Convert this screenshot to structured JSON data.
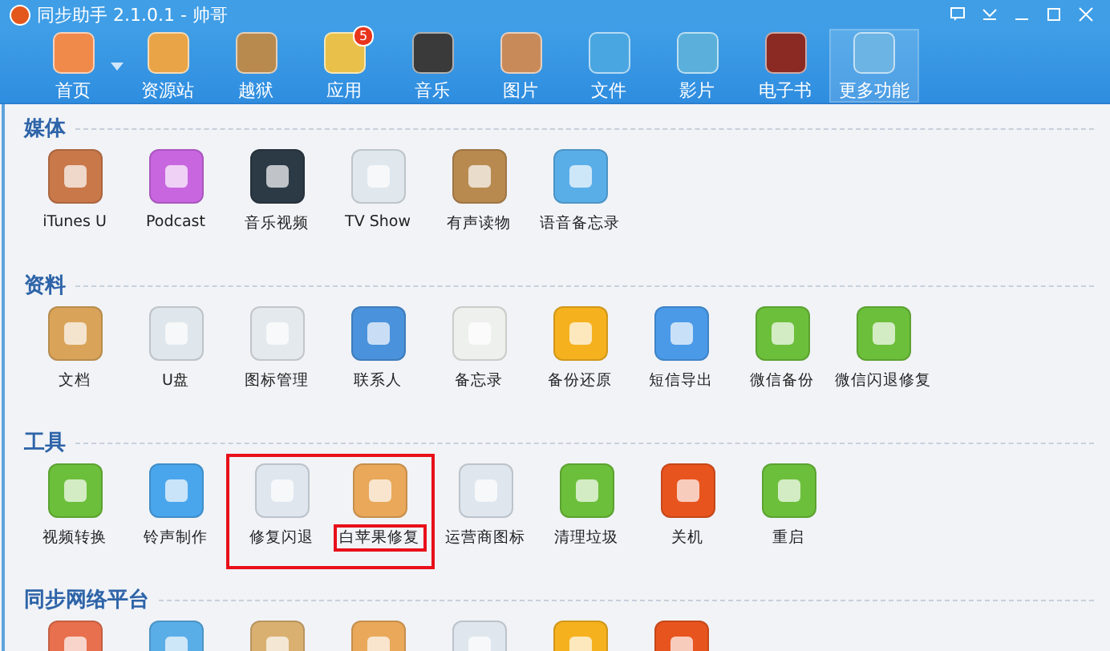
{
  "window": {
    "title": "同步助手 2.1.0.1 - 帅哥"
  },
  "toolbar": [
    {
      "label": "首页",
      "selected": false,
      "color": "#f08a4b",
      "dropdown": true
    },
    {
      "label": "资源站",
      "selected": false,
      "color": "#e9a447"
    },
    {
      "label": "越狱",
      "selected": false,
      "color": "#b98a4e"
    },
    {
      "label": "应用",
      "selected": false,
      "color": "#e9c04a",
      "badge": "5"
    },
    {
      "label": "音乐",
      "selected": false,
      "color": "#3a3a3a"
    },
    {
      "label": "图片",
      "selected": false,
      "color": "#c98a5a"
    },
    {
      "label": "文件",
      "selected": false,
      "color": "#4aa6e0"
    },
    {
      "label": "影片",
      "selected": false,
      "color": "#5ab0da"
    },
    {
      "label": "电子书",
      "selected": false,
      "color": "#8a2a22"
    },
    {
      "label": "更多功能",
      "selected": true,
      "color": "#6cb4e4"
    }
  ],
  "sections": [
    {
      "title": "媒体",
      "items": [
        {
          "label": "iTunes U",
          "color": "#c9784a"
        },
        {
          "label": "Podcast",
          "color": "#c866e0"
        },
        {
          "label": "音乐视频",
          "color": "#2c3a46"
        },
        {
          "label": "TV Show",
          "color": "#e0e8ee"
        },
        {
          "label": "有声读物",
          "color": "#b98a50"
        },
        {
          "label": "语音备忘录",
          "color": "#5aaee8"
        }
      ]
    },
    {
      "title": "资料",
      "items": [
        {
          "label": "文档",
          "color": "#d9a45a"
        },
        {
          "label": "U盘",
          "color": "#dfe6ec"
        },
        {
          "label": "图标管理",
          "color": "#e4e9ee"
        },
        {
          "label": "联系人",
          "color": "#4a92dc"
        },
        {
          "label": "备忘录",
          "color": "#eef0ee"
        },
        {
          "label": "备份还原",
          "color": "#f5b21e"
        },
        {
          "label": "短信导出",
          "color": "#4a9ae8"
        },
        {
          "label": "微信备份",
          "color": "#6cbf3a"
        },
        {
          "label": "微信闪退修复",
          "color": "#6cbf3a"
        }
      ]
    },
    {
      "title": "工具",
      "items": [
        {
          "label": "视频转换",
          "color": "#6cbf3a",
          "boxed": false,
          "label_boxed": false
        },
        {
          "label": "铃声制作",
          "color": "#4aa6ec",
          "boxed": false,
          "label_boxed": false
        },
        {
          "label": "修复闪退",
          "color": "#dfe6ee",
          "boxed": true,
          "label_boxed": false
        },
        {
          "label": "白苹果修复",
          "color": "#e9a85a",
          "boxed": true,
          "label_boxed": true
        },
        {
          "label": "运营商图标",
          "color": "#dfe6ee",
          "boxed": false,
          "label_boxed": false
        },
        {
          "label": "清理垃圾",
          "color": "#6cbf3a",
          "boxed": false,
          "label_boxed": false
        },
        {
          "label": "关机",
          "color": "#e8541e",
          "boxed": false,
          "label_boxed": false
        },
        {
          "label": "重启",
          "color": "#6cbf3a",
          "boxed": false,
          "label_boxed": false
        }
      ]
    },
    {
      "title": "同步网络平台",
      "items": [
        {
          "color": "#e8704e"
        },
        {
          "color": "#5aaee8"
        },
        {
          "color": "#d9b070"
        },
        {
          "color": "#e9a85a"
        },
        {
          "color": "#dfe6ee"
        },
        {
          "color": "#f5b21e"
        },
        {
          "color": "#e8541e"
        }
      ]
    }
  ]
}
